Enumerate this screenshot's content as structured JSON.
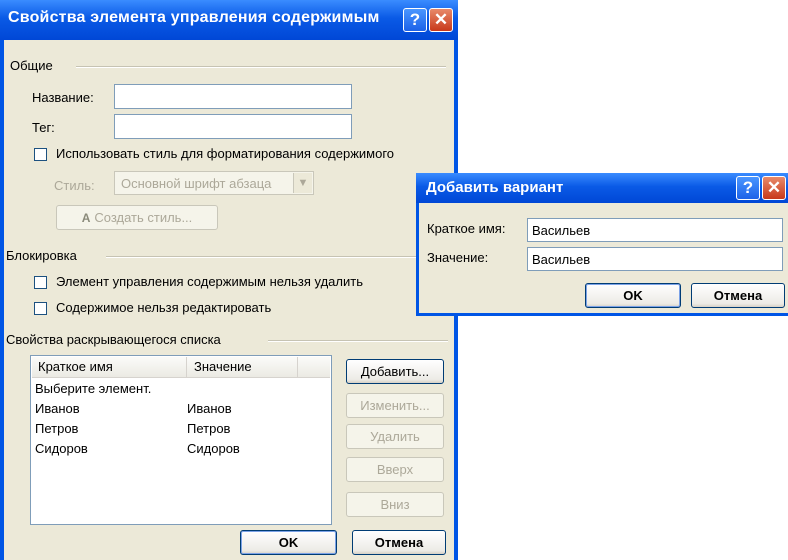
{
  "main_dialog": {
    "title": "Свойства элемента управления содержимым",
    "help_glyph": "?",
    "close_glyph": "✕",
    "general": {
      "heading": "Общие",
      "name_label": "Название:",
      "name_value": "",
      "tag_label": "Тег:",
      "tag_value": "",
      "use_style_label": "Использовать стиль для форматирования содержимого",
      "style_label": "Стиль:",
      "style_value": "Основной шрифт абзаца",
      "create_style_label": "Создать стиль..."
    },
    "lock": {
      "heading": "Блокировка",
      "cannot_delete_label": "Элемент управления содержимым нельзя удалить",
      "cannot_edit_label": "Содержимое нельзя редактировать"
    },
    "dropdown_props": {
      "heading": "Свойства раскрывающегося списка",
      "columns": [
        "Краткое имя",
        "Значение"
      ],
      "rows": [
        {
          "name": "Выберите элемент.",
          "value": ""
        },
        {
          "name": "Иванов",
          "value": "Иванов"
        },
        {
          "name": "Петров",
          "value": "Петров"
        },
        {
          "name": "Сидоров",
          "value": "Сидоров"
        }
      ],
      "add_button": "Добавить...",
      "edit_button": "Изменить...",
      "delete_button": "Удалить",
      "up_button": "Вверх",
      "down_button": "Вниз"
    },
    "ok_button": "OK",
    "cancel_button": "Отмена"
  },
  "add_dialog": {
    "title": "Добавить вариант",
    "help_glyph": "?",
    "close_glyph": "✕",
    "short_name_label": "Краткое имя:",
    "short_name_value": "Васильев",
    "value_label": "Значение:",
    "value_value": "Васильев",
    "ok_button": "OK",
    "cancel_button": "Отмена"
  }
}
